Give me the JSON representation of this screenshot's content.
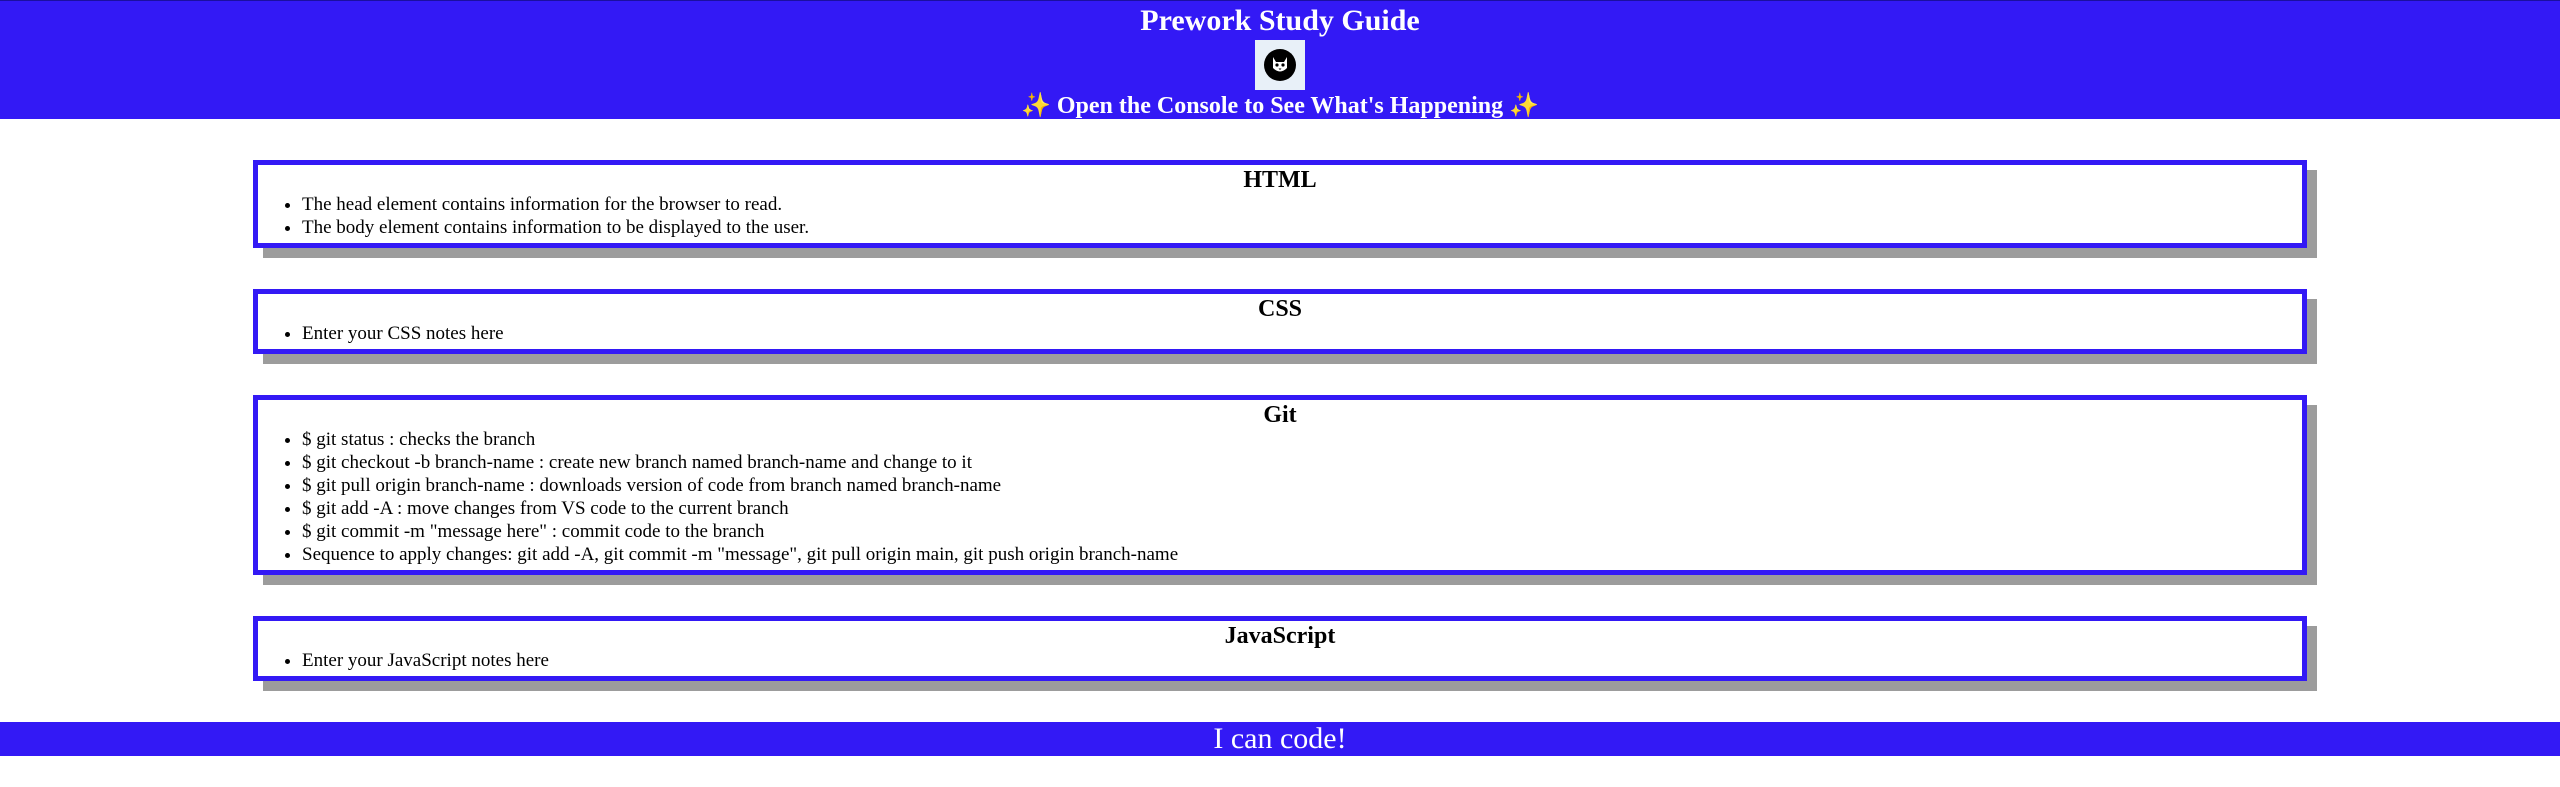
{
  "header": {
    "title": "Prework Study Guide",
    "subtitle": "✨ Open the Console to See What's Happening ✨",
    "logo_icon": "cat-avatar-icon"
  },
  "sections": [
    {
      "heading": "HTML",
      "items": [
        "The head element contains information for the browser to read.",
        "The body element contains information to be displayed to the user."
      ]
    },
    {
      "heading": "CSS",
      "items": [
        "Enter your CSS notes here"
      ]
    },
    {
      "heading": "Git",
      "items": [
        "$ git status : checks the branch",
        "$ git checkout -b branch-name : create new branch named branch-name and change to it",
        "$ git pull origin branch-name : downloads version of code from branch named branch-name",
        "$ git add -A : move changes from VS code to the current branch",
        "$ git commit -m \"message here\" : commit code to the branch",
        "Sequence to apply changes: git add -A, git commit -m \"message\", git pull origin main, git push origin branch-name"
      ]
    },
    {
      "heading": "JavaScript",
      "items": [
        "Enter your JavaScript notes here"
      ]
    }
  ],
  "footer": {
    "text": "I can code!"
  },
  "colors": {
    "accent": "#3319f5",
    "shadow": "#9c9c9c"
  }
}
